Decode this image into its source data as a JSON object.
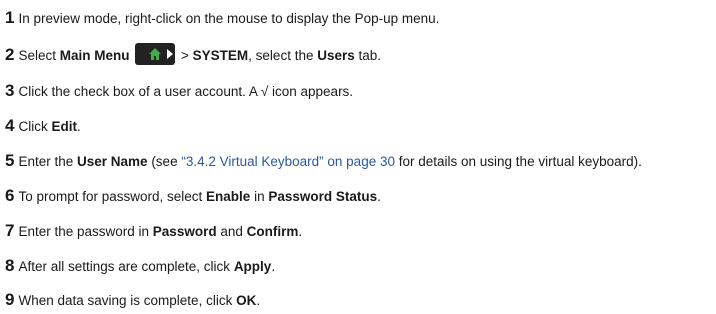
{
  "steps": [
    {
      "number": "1",
      "text": "In preview mode, right-click on the mouse to display the Pop-up menu."
    },
    {
      "number": "2",
      "pre": "Select ",
      "bold1": "Main Menu",
      "mid": " > ",
      "bold2": "SYSTEM",
      "mid2": ", select the ",
      "bold3": "Users",
      "post": " tab.",
      "icon": "home-icon"
    },
    {
      "number": "3",
      "text": "Click the check box of a user account. A √ icon appears."
    },
    {
      "number": "4",
      "pre": "Click ",
      "bold1": "Edit",
      "post": "."
    },
    {
      "number": "5",
      "pre": "Enter the ",
      "bold1": "User Name",
      "mid": " (see ",
      "link": "“3.4.2 Virtual Keyboard” on page 30",
      "post": " for details on using the virtual keyboard)."
    },
    {
      "number": "6",
      "pre": "To prompt for password, select ",
      "bold1": "Enable",
      "mid": " in ",
      "bold2": "Password Status",
      "post": "."
    },
    {
      "number": "7",
      "pre": "Enter the password in ",
      "bold1": "Password",
      "mid": " and ",
      "bold2": "Confirm",
      "post": "."
    },
    {
      "number": "8",
      "pre": "After all settings are complete, click ",
      "bold1": "Apply",
      "post": "."
    },
    {
      "number": "9",
      "pre": "When data saving is complete, click ",
      "bold1": "OK",
      "post": "."
    }
  ],
  "colors": {
    "text": "#1a1a1a",
    "link": "#2a5aa0",
    "icon_bg": "#222222",
    "icon_house": "#3fae49"
  }
}
